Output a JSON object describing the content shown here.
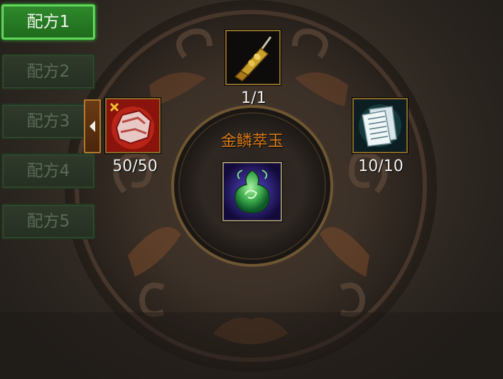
{
  "tabs": [
    {
      "label": "配方1",
      "active": true
    },
    {
      "label": "配方2",
      "active": false
    },
    {
      "label": "配方3",
      "active": false
    },
    {
      "label": "配方4",
      "active": false
    },
    {
      "label": "配方5",
      "active": false
    }
  ],
  "recipe": {
    "result_name": "金鳞萃玉",
    "top_material": {
      "icon": "golden-scepter-icon",
      "count": "1/1"
    },
    "left_material": {
      "icon": "red-ore-icon",
      "count": "50/50"
    },
    "right_material": {
      "icon": "scroll-pages-icon",
      "count": "10/10"
    },
    "result_item": {
      "icon": "green-jade-icon"
    }
  },
  "colors": {
    "active_tab": "#2f8a2c",
    "title": "#d67a1a",
    "slot_border": "#8a6a2a"
  }
}
